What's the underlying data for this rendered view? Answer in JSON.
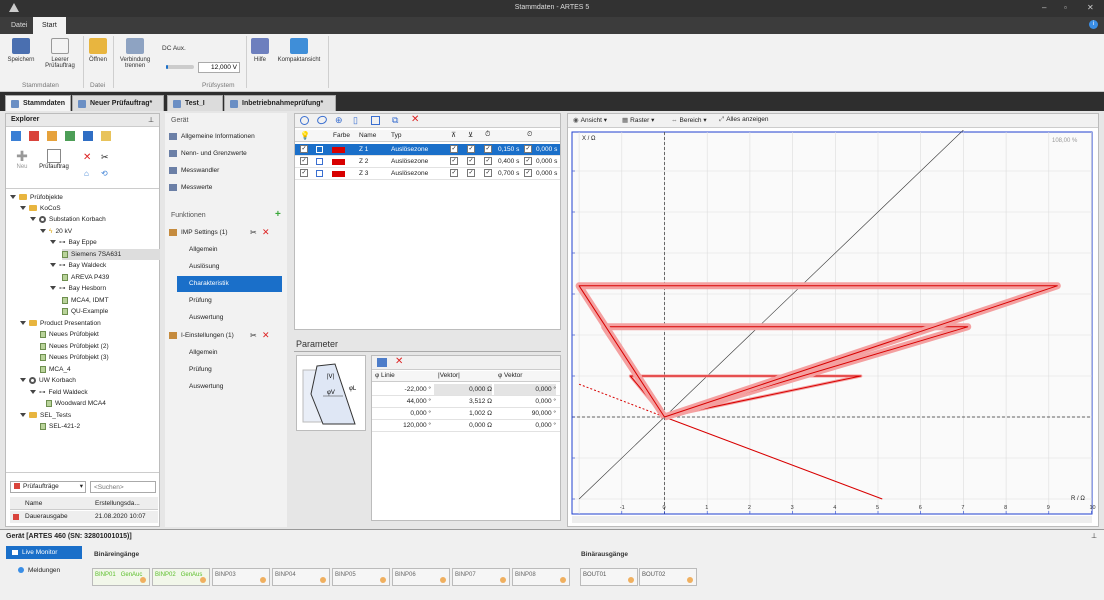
{
  "window": {
    "title": "Stammdaten - ARTES 5"
  },
  "menu_tabs": [
    {
      "label": "Datei"
    },
    {
      "label": "Start"
    }
  ],
  "ribbon": {
    "buttons": [
      {
        "label": "Speichern"
      },
      {
        "label": "Leerer Prüfauftrag"
      },
      {
        "label": "Öffnen"
      },
      {
        "label": "Verbindung trennen"
      },
      {
        "label": "Hilfe"
      },
      {
        "label": "Kompaktansicht"
      }
    ],
    "dc_aux_label": "DC Aux.",
    "dc_aux_value": "12,000 V",
    "dc_aux_slider_fraction": 0.08,
    "groups": [
      {
        "label": "Stammdaten"
      },
      {
        "label": "Datei"
      },
      {
        "label": "Prüfsystem"
      }
    ]
  },
  "doc_tabs": [
    {
      "label": "Stammdaten"
    },
    {
      "label": "Neuer Prüfauftrag*"
    },
    {
      "label": "Test_I"
    },
    {
      "label": "Inbetriebnahmeprüfung*"
    }
  ],
  "explorer": {
    "title": "Explorer",
    "pin": "⊥",
    "actions": [
      {
        "label": "Neu"
      },
      {
        "label": "Prüfauftrag"
      }
    ],
    "tree": [
      {
        "label": "Prüfobjekte"
      },
      {
        "label": "KoCoS"
      },
      {
        "label": "Substation Korbach"
      },
      {
        "label": "20 kV"
      },
      {
        "label": "Bay Eppe"
      },
      {
        "label": "Siemens 7SA631"
      },
      {
        "label": "Bay Waldeck"
      },
      {
        "label": "AREVA P439"
      },
      {
        "label": "Bay Hesborn"
      },
      {
        "label": "MCA4, IDMT"
      },
      {
        "label": "QU-Example"
      },
      {
        "label": "Product Presentation"
      },
      {
        "label": "Neues Prüfobjekt"
      },
      {
        "label": "Neues Prüfobjekt (2)"
      },
      {
        "label": "Neues Prüfobjekt (3)"
      },
      {
        "label": "MCA_4"
      },
      {
        "label": "UW Korbach"
      },
      {
        "label": "Feld Waldeck"
      },
      {
        "label": "Woodward MCA4"
      },
      {
        "label": "SEL_Tests"
      },
      {
        "label": "SEL-421-2"
      }
    ],
    "filter_select": "Prüfaufträge",
    "search_placeholder": "<Suchen>",
    "list_headers": [
      "Name",
      "Erstellungsda..."
    ],
    "list_rows": [
      {
        "name": "Dauerausgabe",
        "date": "21.08.2020 10:07"
      }
    ]
  },
  "nav": {
    "section_geraet": "Gerät",
    "geraet_items": [
      "Allgemeine Informationen",
      "Nenn- und Grenzwerte",
      "Messwandler",
      "Messwerte"
    ],
    "section_funktionen": "Funktionen",
    "imp_title": "IMP Settings (1)",
    "imp_items": [
      "Allgemein",
      "Auslösung",
      "Charakteristik",
      "Prüfung",
      "Auswertung"
    ],
    "i_title": "I-Einstellungen (1)",
    "i_items": [
      "Allgemein",
      "Prüfung",
      "Auswertung"
    ]
  },
  "zones": {
    "headers": [
      "Farbe",
      "Name",
      "Typ"
    ],
    "rows": [
      {
        "name": "Z 1",
        "type": "Auslösezone",
        "t1": "0,150 s",
        "t2": "0,000 s"
      },
      {
        "name": "Z 2",
        "type": "Auslösezone",
        "t1": "0,400 s",
        "t2": "0,000 s"
      },
      {
        "name": "Z 3",
        "type": "Auslösezone",
        "t1": "0,700 s",
        "t2": "0,000 s"
      }
    ],
    "zone_color": "#d80000"
  },
  "parameter": {
    "title": "Parameter",
    "diagram_labels": [
      "|V|",
      "φL",
      "φV"
    ],
    "headers": [
      "φ Linie",
      "|Vektor|",
      "φ Vektor"
    ],
    "rows": [
      [
        "-22,000 °",
        "0,000 Ω",
        "0,000 °"
      ],
      [
        "44,000 °",
        "3,512 Ω",
        "0,000 °"
      ],
      [
        "0,000 °",
        "1,002 Ω",
        "90,000 °"
      ],
      [
        "120,000 °",
        "0,000 Ω",
        "0,000 °"
      ]
    ]
  },
  "chart_toolbar": {
    "ansicht": "Ansicht",
    "raster": "Raster",
    "bereich": "Bereich",
    "alles": "Alles anzeigen"
  },
  "chart_data": {
    "type": "line",
    "ylabel": "X / Ω",
    "xlabel": "R / Ω",
    "zoom": "108,00 %",
    "x_ticks": [
      "-1",
      "0",
      "1",
      "2",
      "3",
      "4",
      "5",
      "6",
      "7",
      "8",
      "9",
      "10"
    ],
    "xlim": [
      -2,
      10
    ],
    "ylim": [
      -2,
      6.8
    ],
    "grid": true,
    "zones": [
      {
        "name": "Z 1",
        "vertices": [
          [
            0,
            0
          ],
          [
            4.6,
            1
          ],
          [
            -0.8,
            1
          ],
          [
            0,
            0
          ]
        ]
      },
      {
        "name": "Z 2",
        "vertices": [
          [
            0,
            0
          ],
          [
            7.1,
            2.2
          ],
          [
            -1.4,
            2.2
          ],
          [
            0,
            0
          ]
        ]
      },
      {
        "name": "Z 3",
        "vertices": [
          [
            0,
            0
          ],
          [
            9.2,
            3.2
          ],
          [
            -2,
            3.2
          ],
          [
            0,
            0
          ]
        ]
      }
    ]
  },
  "device_bar": {
    "title": "Gerät [ARTES 460 (SN: 32801001015)]",
    "tabs": [
      {
        "label": "Live Monitor"
      },
      {
        "label": "Meldungen"
      }
    ],
    "binary_inputs_title": "Binäreingänge",
    "binary_outputs_title": "Binärausgänge",
    "inputs": [
      {
        "label": "BINP01",
        "state": "GenAuc",
        "active": true
      },
      {
        "label": "BINP02",
        "state": "GenAus",
        "active": true
      },
      {
        "label": "BINP03",
        "state": "",
        "active": false
      },
      {
        "label": "BINP04",
        "state": "",
        "active": false
      },
      {
        "label": "BINP05",
        "state": "",
        "active": false
      },
      {
        "label": "BINP06",
        "state": "",
        "active": false
      },
      {
        "label": "BINP07",
        "state": "",
        "active": false
      },
      {
        "label": "BINP08",
        "state": "",
        "active": false
      }
    ],
    "outputs": [
      {
        "label": "BOUT01"
      },
      {
        "label": "BOUT02"
      }
    ]
  }
}
